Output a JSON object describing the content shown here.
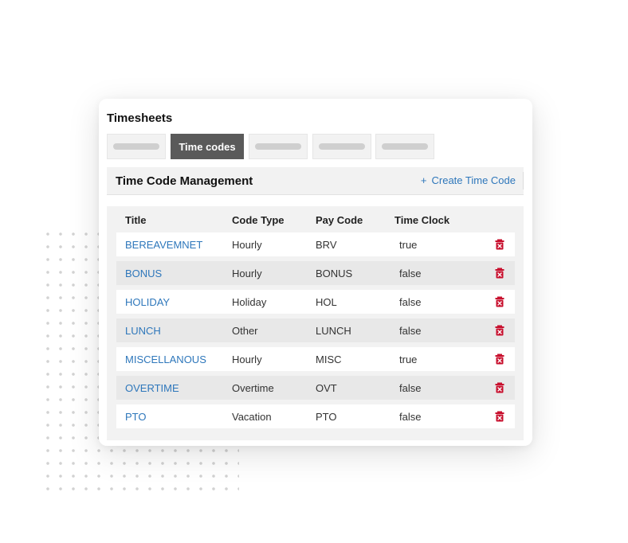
{
  "app": {
    "title": "Timesheets"
  },
  "tabs": [
    {
      "label": "",
      "active": false
    },
    {
      "label": "Time codes",
      "active": true
    },
    {
      "label": "",
      "active": false
    },
    {
      "label": "",
      "active": false
    },
    {
      "label": "",
      "active": false
    }
  ],
  "section": {
    "title": "Time Code Management",
    "create_label": "Create Time Code",
    "create_icon": "plus-icon"
  },
  "table": {
    "headers": {
      "title": "Title",
      "code_type": "Code Type",
      "pay_code": "Pay Code",
      "time_clock": "Time Clock"
    },
    "rows": [
      {
        "title": "BEREAVEMNET",
        "code_type": "Hourly",
        "pay_code": "BRV",
        "time_clock": "true"
      },
      {
        "title": "BONUS",
        "code_type": "Hourly",
        "pay_code": "BONUS",
        "time_clock": "false"
      },
      {
        "title": "HOLIDAY",
        "code_type": "Holiday",
        "pay_code": "HOL",
        "time_clock": "false"
      },
      {
        "title": "LUNCH",
        "code_type": "Other",
        "pay_code": "LUNCH",
        "time_clock": "false"
      },
      {
        "title": "MISCELLANOUS",
        "code_type": "Hourly",
        "pay_code": "MISC",
        "time_clock": "true"
      },
      {
        "title": "OVERTIME",
        "code_type": "Overtime",
        "pay_code": "OVT",
        "time_clock": "false"
      },
      {
        "title": "PTO",
        "code_type": "Vacation",
        "pay_code": "PTO",
        "time_clock": "false"
      }
    ],
    "row_action_icon": "trash-icon"
  },
  "colors": {
    "link": "#2e77bb",
    "active_tab": "#5a5a5a",
    "delete": "#c8102e"
  }
}
